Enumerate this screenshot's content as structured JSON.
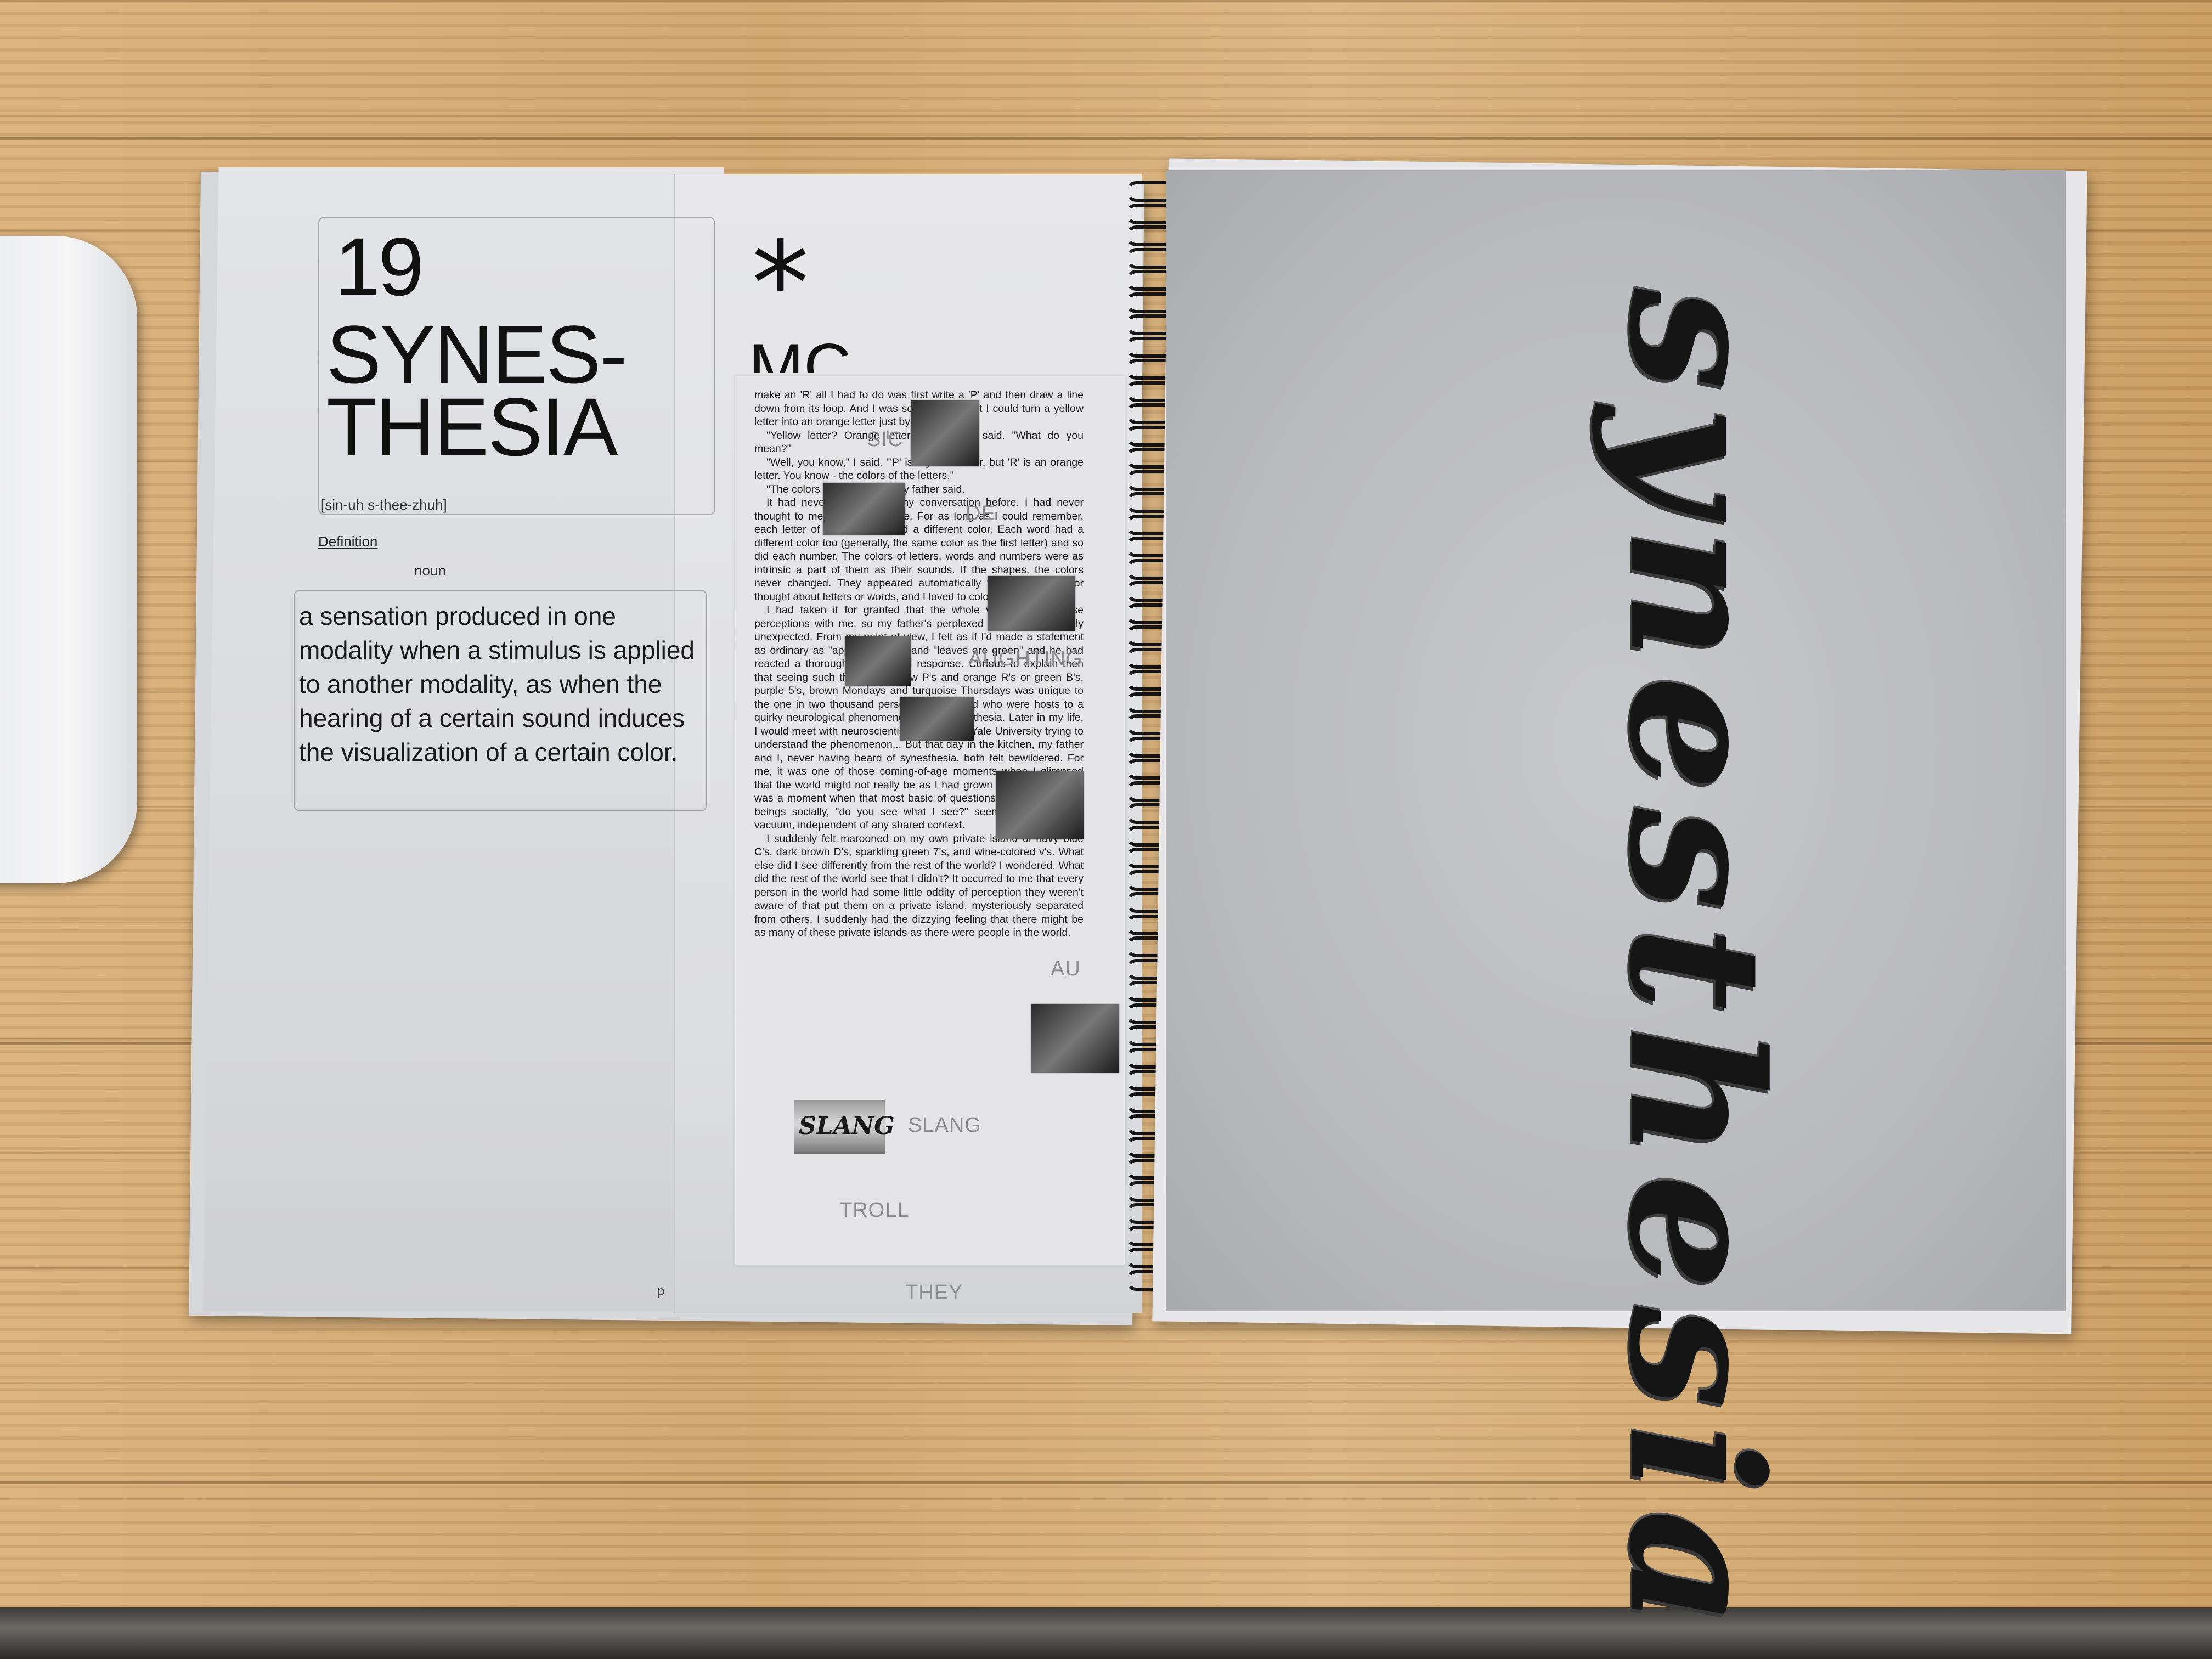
{
  "book": {
    "left_page": {
      "number": "19",
      "title_line1": "SYNES-",
      "title_line2": "THESIA",
      "pronunciation": "[sin-uh s-thee-zhuh]",
      "definition_label": "Definition",
      "part_of_speech": "noun",
      "definition_text": "a sensation produced in one modality when a stimulus is applied to another modality, as when the hearing of a certain sound induces the visualization of a certain color.",
      "corner_mark": "p"
    },
    "middle_page": {
      "symbol": "*",
      "heading_fragment": "MC",
      "essay_paragraphs": [
        "make an 'R' all I had to do was first write a 'P' and then draw a line down from its loop. And I was so surprised that I could turn a yellow letter into an orange letter just by adding a line.",
        "\"Yellow letter? Orange letter?\" my father said. \"What do you mean?\"",
        "\"Well, you know,\" I said. \"'P' is a yellow letter, but 'R' is an orange letter. You know - the colors of the letters.\"",
        "\"The colors of the letters?\" my father said.",
        "It had never come up in any conversation before. I had never thought to mention it to anyone. For as long as I could remember, each letter of the alphabet had a different color. Each word had a different color too (generally, the same color as the first letter) and so did each number. The colors of letters, words and numbers were as intrinsic a part of them as their sounds. If the shapes, the colors never changed. They appeared automatically whenever I saw or thought about letters or words, and I loved to color them.",
        "I had taken it for granted that the whole world shared these perceptions with me, so my father's perplexed reaction was totally unexpected. From my point of view, I felt as if I'd made a statement as ordinary as \"apples are red\" and \"leaves are green\" and he had reacted a thoroughly bewildered response. Curious to explain then that seeing such things as yellow P's and orange R's or green B's, purple 5's, brown Mondays and turquoise Thursdays was unique to the one in two thousand persons in the world who were hosts to a quirky neurological phenomenon called synesthesia. Later in my life, I would meet with neuroscientists at NIH and Yale University trying to understand the phenomenon... But that day in the kitchen, my father and I, never having heard of synesthesia, both felt bewildered. For me, it was one of those coming-of-age moments when I glimpsed that the world might not really be as I had grown up perceiving it. It was a moment when that most basic of questions that binds human beings socially, \"do you see what I see?\" seemed to hang in a vacuum, independent of any shared context.",
        "I suddenly felt marooned on my own private island of navy blue C's, dark brown D's, sparkling green 7's, and wine-colored v's. What else did I see differently from the rest of the world? I wondered. What did the rest of the world see that I didn't? It occurred to me that every person in the world had some little oddity of perception they weren't aware of that put them on a private island, mysteriously separated from others. I suddenly had the dizzying feeling that there might be as many of these private islands as there were people in the world."
      ],
      "ghost_words": [
        "SIC",
        "DE",
        "AUGHTING",
        "SLANG",
        "TROLL",
        "THEY",
        "AU"
      ],
      "slang_image_text": "SLANG"
    },
    "right_page": {
      "brush_word": "synesthesia"
    }
  },
  "colors": {
    "paper": "#e3e4e7",
    "ink": "#111111",
    "ghost_gray": "#8a8b8e",
    "wood": "#d0a56d"
  }
}
